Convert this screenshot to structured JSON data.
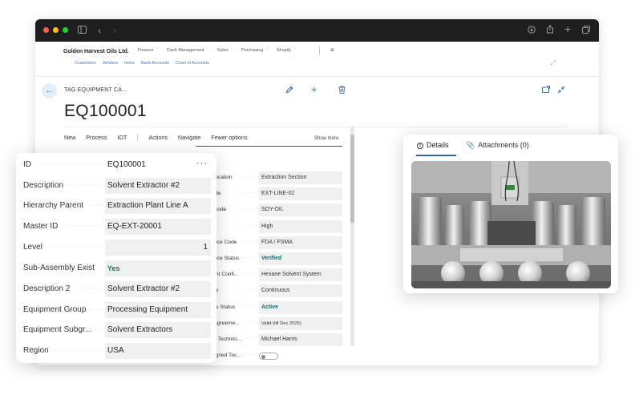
{
  "app": {
    "company": "Golden Harvest Oils Ltd.",
    "menu": [
      "Finance",
      "Cash Management",
      "Sales",
      "Purchasing",
      "Shopify"
    ],
    "sublinks": [
      "Customers",
      "Vendors",
      "Items",
      "Bank Accounts",
      "Chart of Accounts"
    ]
  },
  "page": {
    "breadcrumb": "TAG EQUIPMENT CA...",
    "record_id": "EQ100001",
    "actions": [
      "New",
      "Process",
      "IOT",
      "Actions",
      "Navigate",
      "Fewer options"
    ],
    "show_more": "Show more"
  },
  "general_fields": [
    {
      "label": "ID",
      "value": "EQ100001",
      "style": "white",
      "more": "···"
    },
    {
      "label": "Description",
      "value": "Solvent Extractor #2",
      "style": "grey"
    },
    {
      "label": "Hierarchy Parent",
      "value": "Extraction Plant Line A",
      "style": "grey"
    },
    {
      "label": "Master ID",
      "value": "EQ-EXT-20001",
      "style": "grey"
    },
    {
      "label": "Level",
      "value": "1",
      "style": "right"
    },
    {
      "label": "Sub-Assembly Exist",
      "value": "Yes",
      "style": "teal"
    },
    {
      "label": "Description 2",
      "value": "Solvent Extractor #2",
      "style": "grey"
    },
    {
      "label": "Equipment Group",
      "value": "Processing Equipment",
      "style": "grey"
    },
    {
      "label": "Equipment Subgr...",
      "value": "Solvent Extractors",
      "style": "grey"
    },
    {
      "label": "Region",
      "value": "USA",
      "style": "grey"
    }
  ],
  "detail_fields": [
    {
      "label": "Current location",
      "value": "Extraction Section",
      "style": "grey"
    },
    {
      "label": "linear code",
      "value": "EXT-LINE-02",
      "style": "grey"
    },
    {
      "label": "process code",
      "value": "SOY-OIL",
      "style": "grey"
    },
    {
      "label": "criticality",
      "value": "High",
      "style": "grey"
    },
    {
      "label": "Compliance Code",
      "value": "FDA / FSMA",
      "style": "grey"
    },
    {
      "label": "Compliance Status",
      "value": "Verified",
      "style": "teal"
    },
    {
      "label": "Equipment Confi...",
      "value": "Hexane Solvent System",
      "style": "grey"
    },
    {
      "label": "Duty Type",
      "value": "Continuous",
      "style": "grey"
    },
    {
      "label": "Duty Type Status",
      "value": "Active",
      "style": "teal"
    },
    {
      "label": "Service Agreeme...",
      "value": "Valid (till Dec 2025)",
      "style": "small"
    },
    {
      "label": "Assigned Technici...",
      "value": "Michael Harris",
      "style": "grey"
    },
    {
      "label": "Use Assigned Tec...",
      "value": "",
      "style": "toggle"
    }
  ],
  "factbox": {
    "tab_details": "Details",
    "tab_attachments": "Attachments (0)"
  },
  "colors": {
    "accent": "#2c6cad",
    "status_teal": "#0f6f73",
    "field_bg": "#f0f0f0"
  }
}
